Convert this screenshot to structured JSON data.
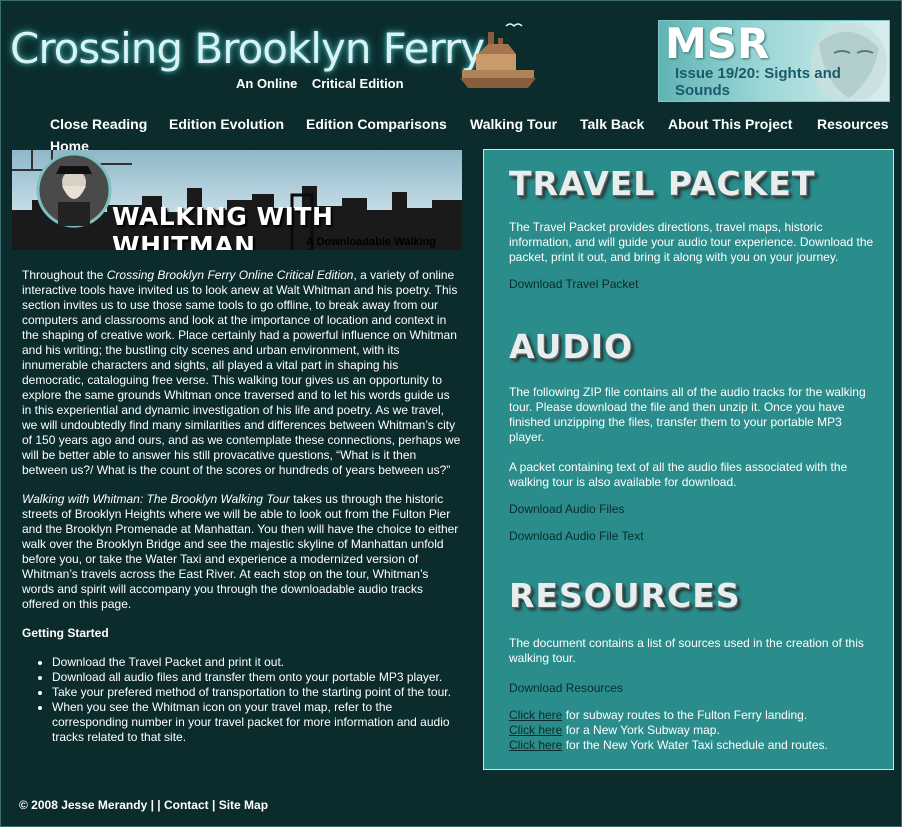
{
  "header": {
    "site_title": "Crossing Brooklyn Ferry",
    "site_subtitle": "An Online    Critical Edition",
    "msr_logo": "MSR",
    "msr_issue": "Issue 19/20: Sights and Sounds"
  },
  "nav": {
    "items": [
      "Close Reading",
      "Edition Evolution",
      "Edition Comparisons",
      "Walking Tour",
      "Talk Back",
      "About This Project",
      "Resources",
      "Home"
    ]
  },
  "banner": {
    "title": "WALKING WITH WHITMAN",
    "subtitle": "A Downloadable Walking Tour"
  },
  "intro": {
    "p1_lead": "Throughout the ",
    "p1_italic": "Crossing Brooklyn Ferry Online Critical Edition",
    "p1_rest": ", a variety of online interactive tools have invited us to look anew at Walt Whitman and his poetry. This section invites us to use those same tools to go offline, to break away from our computers and classrooms and look at the importance of location and context in the shaping of creative work.   Place certainly had a powerful influence on Whitman and his writing; the bustling city scenes and urban environment, with its innumerable characters and sights, all played a vital part in shaping his democratic, cataloguing free verse.  This walking tour gives us an opportunity to explore the same grounds Whitman once traversed and to let his words guide us in this experiential and dynamic investigation of his life and poetry.  As we travel, we will undoubtedly find many similarities and differences between Whitman’s city of 150 years ago and ours, and as we contemplate these connections, perhaps we will be better able to answer his still provacative  questions, “What is it then between us?/ What is the count of the scores or hundreds of years between us?”",
    "p2_italic": "Walking with Whitman: The Brooklyn Walking Tour",
    "p2_rest": " takes us through the historic streets of Brooklyn Heights where we will be able to look out from the Fulton Pier and the Brooklyn Promenade at Manhattan. You then will have the choice to either walk over the Brooklyn Bridge and see the majestic skyline of Manhattan unfold before you, or take the Water Taxi and experience a modernized version of Whitman’s travels across the East River. At each stop on the tour, Whitman’s words and spirit will accompany you through the downloadable audio tracks offered on this page.",
    "getting_started": "Getting Started",
    "steps": [
      "Download the Travel Packet and print it out.",
      "Download all audio files and transfer them onto your portable MP3 player.",
      "Take your prefered method of transportation to the starting point of the tour.",
      "When you see the Whitman icon on your travel map, refer to the corresponding number in your travel packet for more information and audio tracks related to that site."
    ]
  },
  "footer": {
    "copyright": "© 2008 Jesse Merandy",
    "sep": " | | ",
    "contact": "Contact",
    "sep2": " | ",
    "sitemap": "Site Map"
  },
  "panel": {
    "travel_heading": "TRAVEL PACKET",
    "travel_text": "The Travel Packet provides directions, travel maps, historic information, and will guide your audio tour experience. Download the packet, print it out, and bring it along with you on your journey.",
    "travel_link": "Download Travel Packet",
    "audio_heading": "AUDIO",
    "audio_text1": "The following ZIP file contains all of the audio tracks for the walking tour. Please download the file and then unzip it. Once you have finished unzipping the files, transfer them to your portable MP3 player.",
    "audio_text2": "A packet containing text of all the audio files associated with the walking tour is also available for download.",
    "audio_link1": "Download Audio Files",
    "audio_link2": "Download Audio File Text",
    "res_heading": "RESOURCES",
    "res_text": "The document contains a list of sources used in the creation of this walking tour.",
    "res_link": "Download Resources",
    "click_here": "Click here",
    "click1_rest": " for subway routes to the Fulton Ferry landing.",
    "click2_rest": " for a New York Subway map.",
    "click3_rest": " for the New York Water Taxi schedule and routes."
  }
}
